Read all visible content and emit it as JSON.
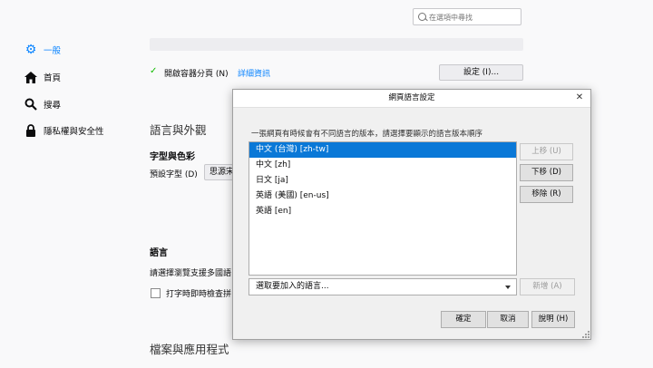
{
  "search": {
    "placeholder": "在選項中尋找"
  },
  "sidebar": {
    "items": [
      {
        "label": "一般",
        "icon": "gear-icon",
        "selected": true
      },
      {
        "label": "首頁",
        "icon": "home-icon",
        "selected": false
      },
      {
        "label": "搜尋",
        "icon": "search-icon",
        "selected": false
      },
      {
        "label": "隱私權與安全性",
        "icon": "lock-icon",
        "selected": false
      }
    ]
  },
  "main": {
    "container_tabs_label": "開啟容器分頁 (N)",
    "learn_more": "詳細資訊",
    "settings_button": "設定 (I)...",
    "section_language_appearance": "語言與外觀",
    "fonts_colors_heading": "字型與色彩",
    "default_font_label": "預設字型 (D)",
    "default_font_value": "思源宋",
    "language_heading": "語言",
    "language_desc": "請選擇瀏覽支援多國語",
    "spellcheck_label": "打字時即時檢查拼",
    "section_files_apps": "檔案與應用程式"
  },
  "dialog": {
    "title": "網頁語言設定",
    "description": "一張網頁有時候會有不同語言的版本，請選擇要顯示的語言版本順序",
    "languages": [
      {
        "label": "中文 (台灣)  [zh-tw]",
        "selected": true
      },
      {
        "label": "中文  [zh]",
        "selected": false
      },
      {
        "label": "日文  [ja]",
        "selected": false
      },
      {
        "label": "英語 (美國)  [en-us]",
        "selected": false
      },
      {
        "label": "英語  [en]",
        "selected": false
      }
    ],
    "move_up": "上移 (U)",
    "move_down": "下移 (D)",
    "remove": "移除 (R)",
    "select_placeholder": "選取要加入的語言...",
    "add": "新增 (A)",
    "ok": "確定",
    "cancel": "取消",
    "help": "說明 (H)"
  },
  "colors": {
    "accent": "#0a84ff",
    "selection": "#0a78d7"
  }
}
